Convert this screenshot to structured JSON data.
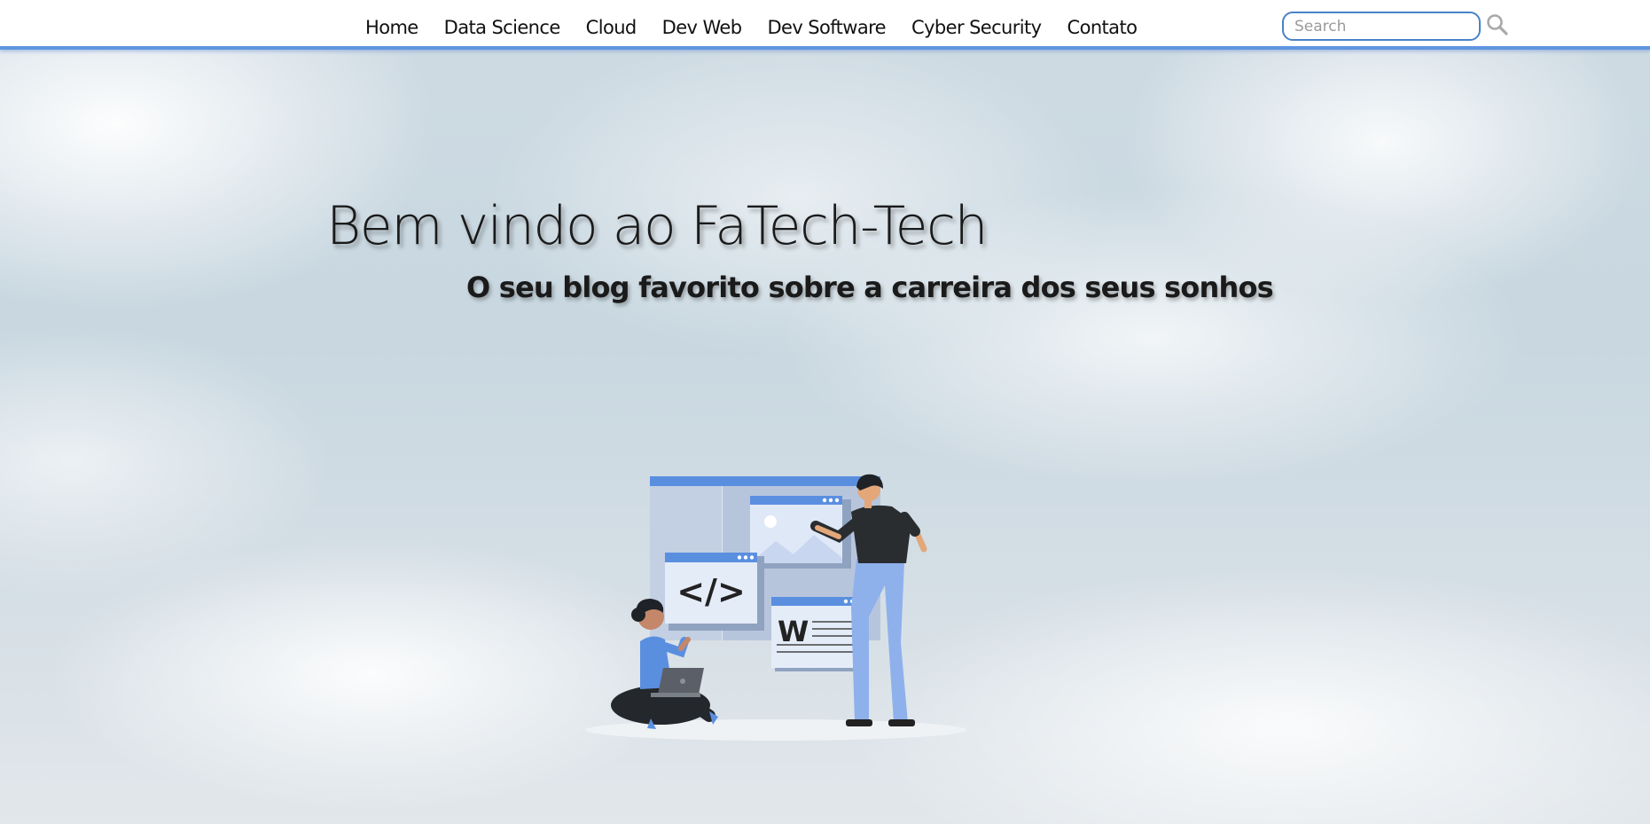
{
  "nav": {
    "items": [
      {
        "label": "Home"
      },
      {
        "label": "Data Science"
      },
      {
        "label": "Cloud"
      },
      {
        "label": "Dev Web"
      },
      {
        "label": "Dev Software"
      },
      {
        "label": "Cyber Security"
      },
      {
        "label": "Contato"
      }
    ],
    "search": {
      "placeholder": "Search",
      "value": "",
      "icon": "search-icon"
    }
  },
  "hero": {
    "title": "Bem vindo ao FaTech-Tech",
    "subtitle": "O seu blog favorito sobre a carreira dos seus sonhos",
    "illustration": {
      "code_symbol": "</>",
      "doc_letter": "W"
    }
  },
  "colors": {
    "accent": "#5e95e0",
    "nav_background": "#ffffff",
    "text": "#1a1a1a",
    "sky": "#c8d7e0"
  }
}
